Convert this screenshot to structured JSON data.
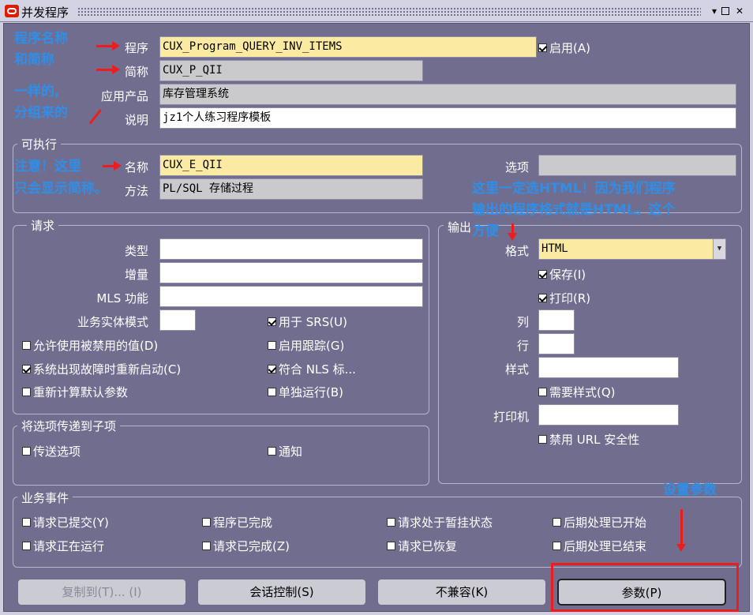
{
  "window": {
    "title": "并发程序"
  },
  "program": {
    "program_label": "程序",
    "program_value": "CUX_Program_QUERY_INV_ITEMS",
    "enabled_label": "启用(A)",
    "short_name_label": "简称",
    "short_name_value": "CUX_P_QII",
    "application_label": "应用产品",
    "application_value": "库存管理系统",
    "description_label": "说明",
    "description_value": "jz1个人练习程序模板"
  },
  "executable": {
    "section_title": "可执行",
    "name_label": "名称",
    "name_value": "CUX_E_QII",
    "options_label": "选项",
    "options_value": "",
    "method_label": "方法",
    "method_value": "PL/SQL 存储过程"
  },
  "request": {
    "section_title": "请求",
    "type_label": "类型",
    "type_value": "",
    "incrementor_label": "增量",
    "incrementor_value": "",
    "mls_label": "MLS 功能",
    "mls_value": "",
    "operating_unit_label": "业务实体模式",
    "operating_unit_value": "",
    "checkboxes": {
      "use_in_srs": {
        "label": "用于 SRS(U)",
        "checked": true
      },
      "allow_disabled": {
        "label": "允许使用被禁用的值(D)",
        "checked": false
      },
      "enable_trace": {
        "label": "启用跟踪(G)",
        "checked": false
      },
      "restart_on_failure": {
        "label": "系统出现故障时重新启动(C)",
        "checked": true
      },
      "nls_compliant": {
        "label": "符合 NLS 标...",
        "checked": true
      },
      "recalc_defaults": {
        "label": "重新计算默认参数",
        "checked": false
      },
      "run_alone": {
        "label": "单独运行(B)",
        "checked": false
      }
    }
  },
  "output": {
    "section_title": "输出",
    "format_label": "格式",
    "format_value": "HTML",
    "save": {
      "label": "保存(I)",
      "checked": true
    },
    "print": {
      "label": "打印(R)",
      "checked": true
    },
    "columns_label": "列",
    "columns_value": "",
    "rows_label": "行",
    "rows_value": "",
    "style_label": "样式",
    "style_value": "",
    "style_required": {
      "label": "需要样式(Q)",
      "checked": false
    },
    "printer_label": "打印机",
    "printer_value": "",
    "disable_url_security": {
      "label": "禁用 URL 安全性",
      "checked": false
    }
  },
  "child_options": {
    "section_title": "将选项传递到子项",
    "pass_options": {
      "label": "传送选项",
      "checked": false
    },
    "notify": {
      "label": "通知",
      "checked": false
    }
  },
  "business_events": {
    "section_title": "业务事件",
    "submitted": {
      "label": "请求已提交(Y)",
      "checked": false
    },
    "program_completed": {
      "label": "程序已完成",
      "checked": false
    },
    "on_hold": {
      "label": "请求处于暂挂状态",
      "checked": false
    },
    "post_start": {
      "label": "后期处理已开始",
      "checked": false
    },
    "running": {
      "label": "请求正在运行",
      "checked": false
    },
    "request_completed": {
      "label": "请求已完成(Z)",
      "checked": false
    },
    "resumed": {
      "label": "请求已恢复",
      "checked": false
    },
    "post_end": {
      "label": "后期处理已结束",
      "checked": false
    }
  },
  "buttons": {
    "copy": "复制到(T)... (I)",
    "session_control": "会话控制(S)",
    "incompatibilities": "不兼容(K)",
    "parameters": "参数(P)"
  },
  "annotations": {
    "program_name_1": "程序名称",
    "program_name_2": "和简称",
    "same_1": "一样的,",
    "same_2": "分组来的",
    "note_1": "注意！这里",
    "note_2": "只会显示简称。",
    "html_1": "这里一定选HTML！因为我们程序",
    "html_2": "输出的程序格式就是HTML。这个",
    "html_3": "方便",
    "params": "设置参数"
  },
  "colors": {
    "accent_annotation": "#2f8fe8",
    "arrow": "#ee1d1d",
    "required_field": "#fbeaa2",
    "window_bg": "#706d8f"
  },
  "icons": [
    "oracle-logo-icon",
    "minimize-icon",
    "maximize-icon",
    "close-icon",
    "dropdown-icon"
  ]
}
